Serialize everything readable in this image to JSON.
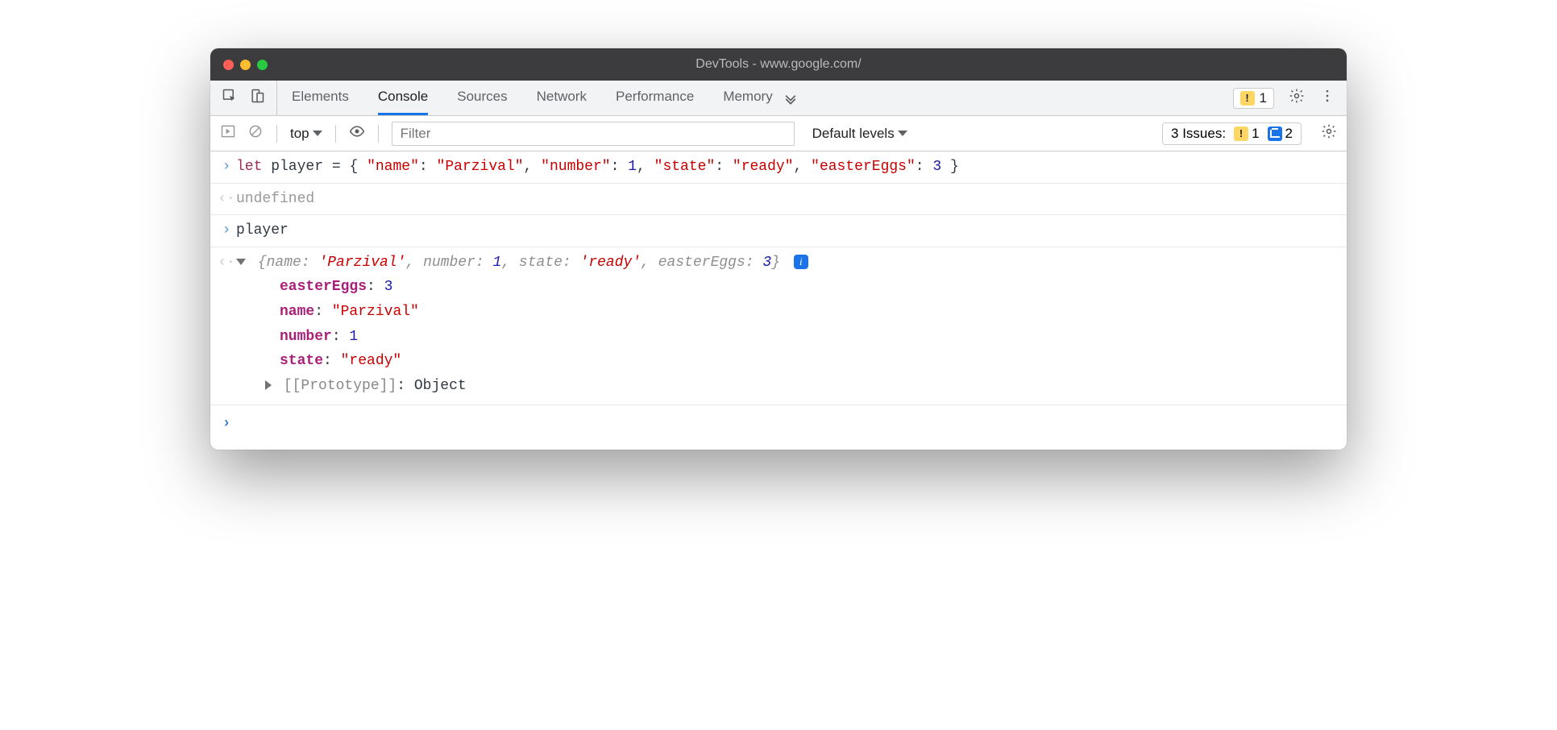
{
  "window": {
    "title": "DevTools - www.google.com/"
  },
  "tabs": {
    "items": [
      "Elements",
      "Console",
      "Sources",
      "Network",
      "Performance",
      "Memory"
    ],
    "active": "Console",
    "hidden_warning_count": "1"
  },
  "toolbar": {
    "context": "top",
    "filter_placeholder": "Filter",
    "levels": "Default levels",
    "issues_label": "3 Issues:",
    "issues_warn_count": "1",
    "issues_info_count": "2"
  },
  "console": {
    "input1_raw": "let player = { \"name\": \"Parzival\", \"number\": 1, \"state\": \"ready\", \"easterEggs\": 3 }",
    "result1": "undefined",
    "input2": "player",
    "object_summary_prefix": "{",
    "object_summary": "name: 'Parzival', number: 1, state: 'ready', easterEggs: 3",
    "object_summary_suffix": "}",
    "props": {
      "easterEggs": {
        "key": "easterEggs",
        "value": "3",
        "type": "number"
      },
      "name": {
        "key": "name",
        "value": "\"Parzival\"",
        "type": "string"
      },
      "number": {
        "key": "number",
        "value": "1",
        "type": "number"
      },
      "state": {
        "key": "state",
        "value": "\"ready\"",
        "type": "string"
      }
    },
    "prototype_label": "[[Prototype]]",
    "prototype_value": "Object"
  }
}
